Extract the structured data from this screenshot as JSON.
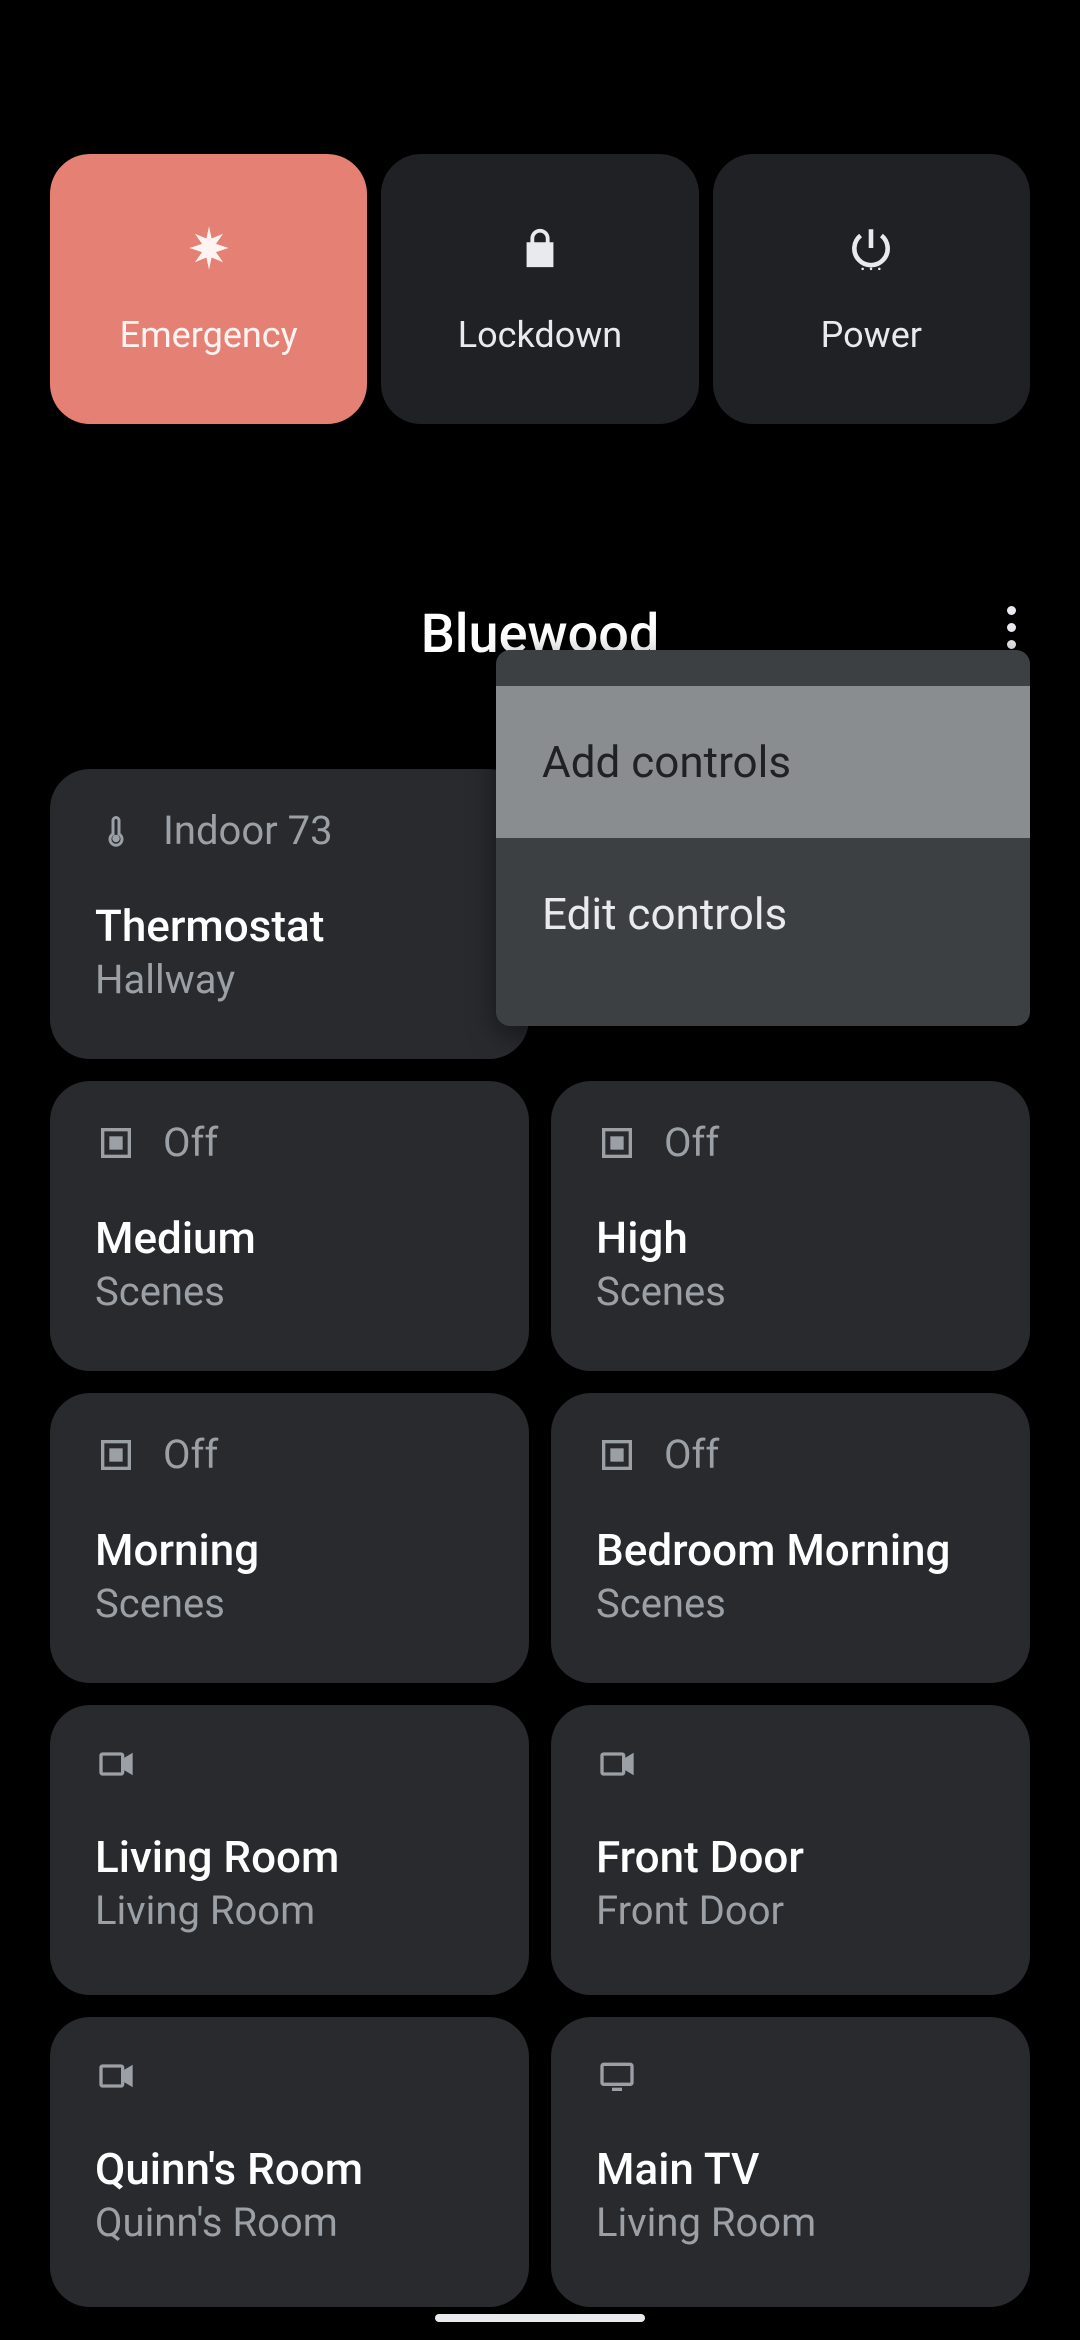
{
  "top_actions": {
    "emergency": {
      "label": "Emergency",
      "icon": "asterisk-icon"
    },
    "lockdown": {
      "label": "Lockdown",
      "icon": "lock-icon"
    },
    "power": {
      "label": "Power",
      "icon": "power-icon"
    }
  },
  "home": {
    "title": "Bluewood"
  },
  "popup": {
    "items": [
      {
        "label": "Add controls",
        "selected": true
      },
      {
        "label": "Edit controls",
        "selected": false
      }
    ]
  },
  "tiles": [
    {
      "icon": "thermometer-icon",
      "status": "Indoor 73",
      "name": "Thermostat",
      "sub": "Hallway"
    },
    {
      "icon": "scene-icon",
      "status": "Off",
      "name": "Medium",
      "sub": "Scenes"
    },
    {
      "icon": "scene-icon",
      "status": "Off",
      "name": "High",
      "sub": "Scenes"
    },
    {
      "icon": "scene-icon",
      "status": "Off",
      "name": "Morning",
      "sub": "Scenes"
    },
    {
      "icon": "scene-icon",
      "status": "Off",
      "name": "Bedroom Morning",
      "sub": "Scenes"
    },
    {
      "icon": "camera-icon",
      "status": "",
      "name": "Living Room",
      "sub": "Living Room"
    },
    {
      "icon": "camera-icon",
      "status": "",
      "name": "Front Door",
      "sub": "Front Door"
    },
    {
      "icon": "camera-icon",
      "status": "",
      "name": "Quinn's Room",
      "sub": "Quinn's Room"
    },
    {
      "icon": "tv-icon",
      "status": "",
      "name": "Main TV",
      "sub": "Living Room"
    }
  ]
}
